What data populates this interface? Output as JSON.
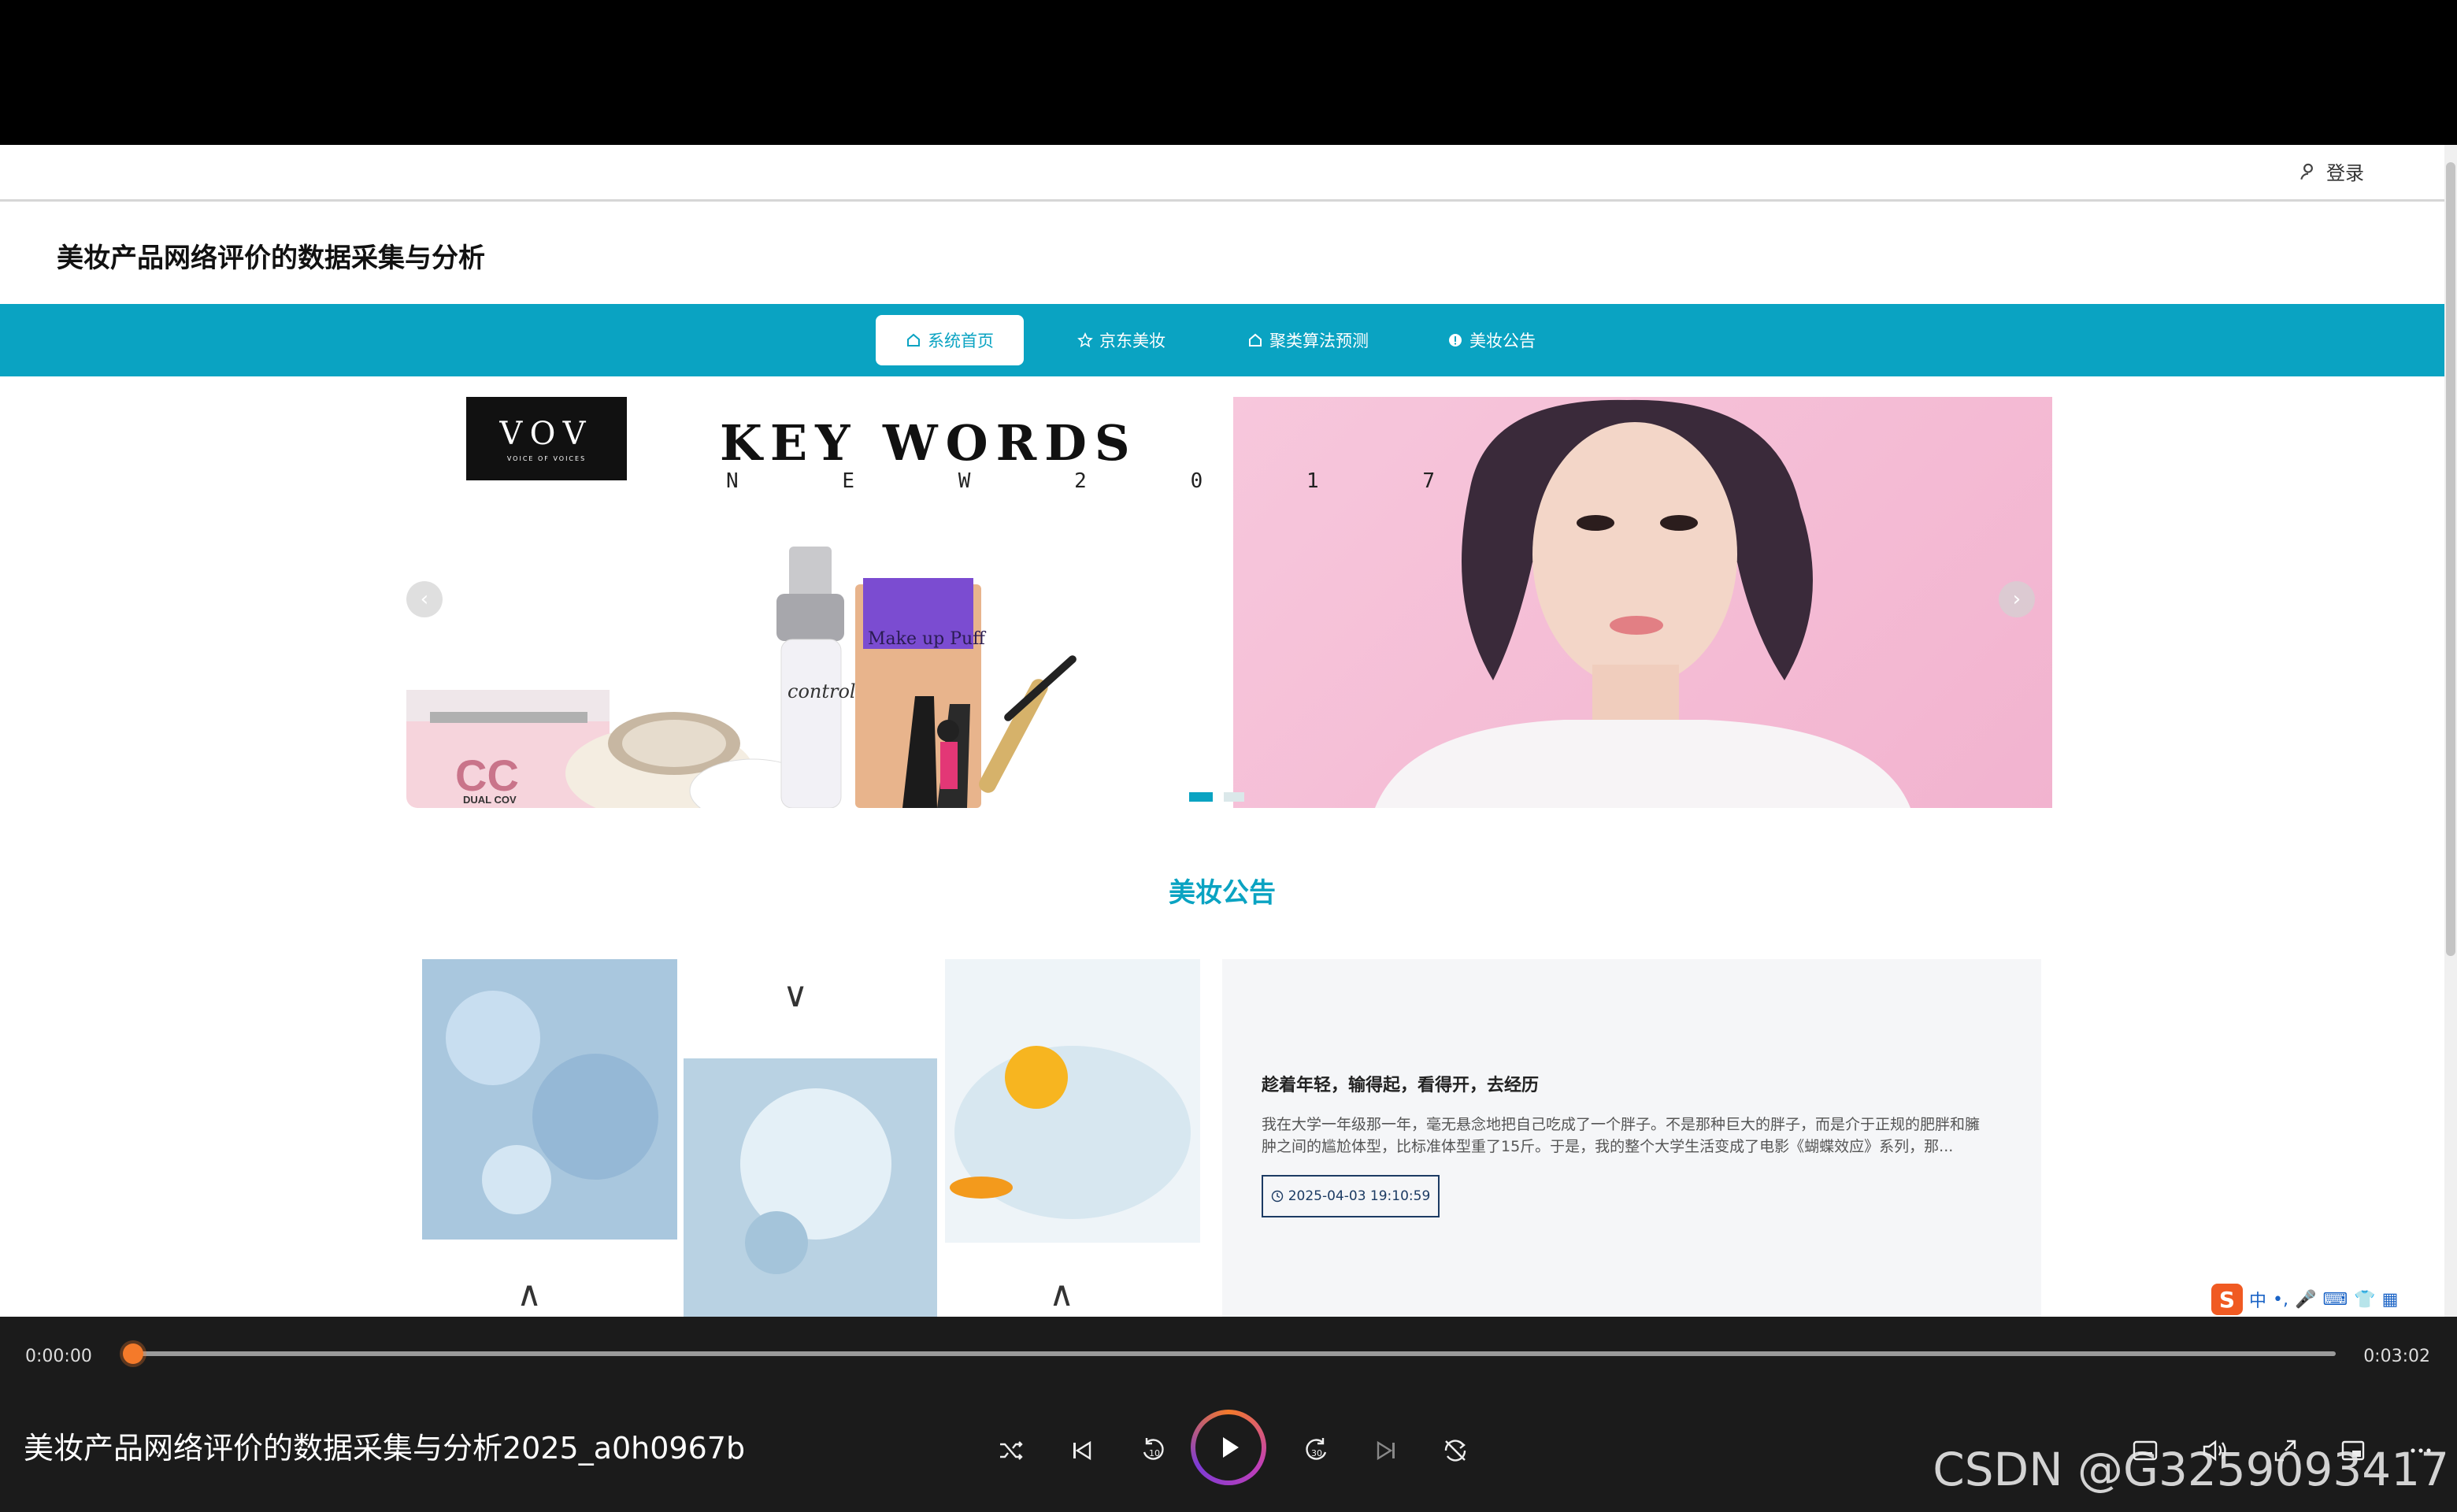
{
  "header": {
    "login_label": "登录"
  },
  "site": {
    "title": "美妆产品网络评价的数据采集与分析"
  },
  "nav": {
    "items": [
      {
        "label": "系统首页",
        "icon": "home-icon",
        "active": true
      },
      {
        "label": "京东美妆",
        "icon": "star-icon",
        "active": false
      },
      {
        "label": "聚类算法预测",
        "icon": "home-icon",
        "active": false
      },
      {
        "label": "美妆公告",
        "icon": "info-icon",
        "active": false
      }
    ]
  },
  "banner": {
    "brand_big": "VOV",
    "brand_small": "VOICE OF VOICES",
    "headline": "KEY WORDS",
    "sub_letters": [
      "N",
      "E",
      "W",
      "2",
      "0",
      "1",
      "7"
    ],
    "product_labels": {
      "cc": "CC",
      "cc_sub": "DUAL COV",
      "control": "control base",
      "puff": "Make up Puff"
    },
    "slide_count": 2,
    "active_slide": 1
  },
  "notice": {
    "section_title": "美妆公告",
    "title": "趁着年轻，输得起，看得开，去经历",
    "text": "我在大学一年级那一年，毫无悬念地把自己吃成了一个胖子。不是那种巨大的胖子，而是介于正规的肥胖和臃肿之间的尴尬体型，比标准体型重了15斤。于是，我的整个大学生活变成了电影《蝴蝶效应》系列，那...",
    "date": "2025-04-03 19:10:59"
  },
  "ime": {
    "lang": "中"
  },
  "player": {
    "current_time": "0:00:00",
    "total_time": "0:03:02",
    "progress": 0,
    "video_title": "美妆产品网络评价的数据采集与分析2025_a0h0967b",
    "watermark": "CSDN @G3259093417",
    "accent": "#f47a2a"
  },
  "colors": {
    "nav": "#0aa3c2",
    "date_border": "#1c3b63"
  }
}
